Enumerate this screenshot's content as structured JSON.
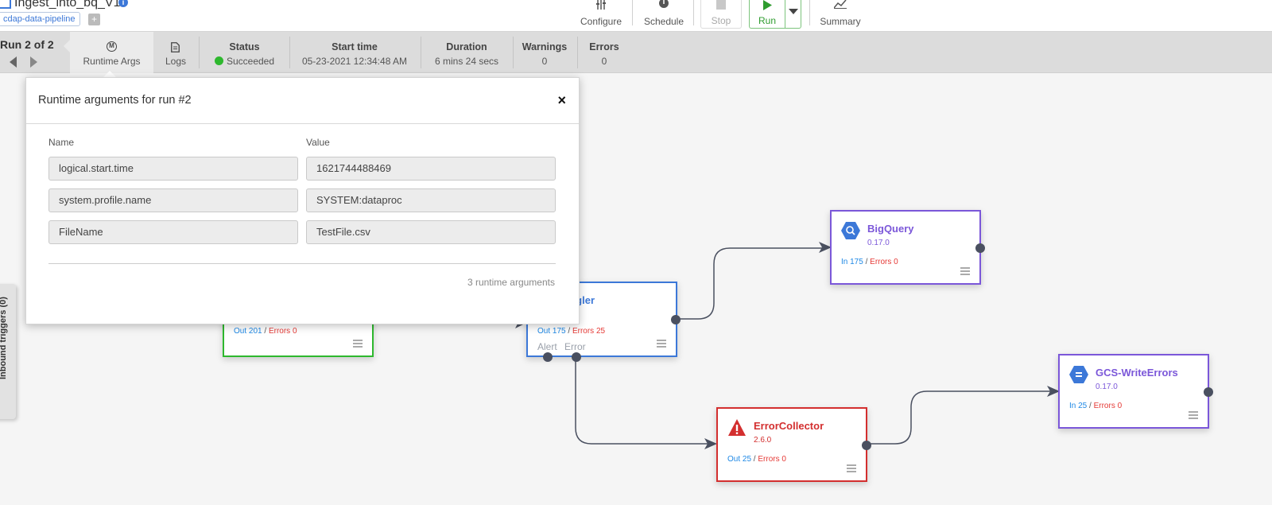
{
  "header": {
    "pipeline_name": "Ingest_into_bq_V1",
    "namespace_tag": "cdap-data-pipeline",
    "add_tag_label": "+",
    "info_label": "i",
    "toolbar": {
      "configure": "Configure",
      "schedule": "Schedule",
      "stop": "Stop",
      "run": "Run",
      "summary": "Summary"
    }
  },
  "run_info": {
    "run_counter": "Run 2 of 2",
    "runtime_args_tab": "Runtime Args",
    "runtime_args_icon_letter": "M",
    "logs_tab": "Logs",
    "status": {
      "label": "Status",
      "value": "Succeeded",
      "color": "#2eb82e"
    },
    "start_time": {
      "label": "Start time",
      "value": "05-23-2021 12:34:48 AM"
    },
    "duration": {
      "label": "Duration",
      "value": "6 mins 24 secs"
    },
    "warnings": {
      "label": "Warnings",
      "value": "0"
    },
    "errors": {
      "label": "Errors",
      "value": "0"
    }
  },
  "modal": {
    "title": "Runtime arguments for run #2",
    "close_label": "×",
    "name_header": "Name",
    "value_header": "Value",
    "args": [
      {
        "name": "logical.start.time",
        "value": "1621744488469"
      },
      {
        "name": "system.profile.name",
        "value": "SYSTEM:dataproc"
      },
      {
        "name": "FileName",
        "value": "TestFile.csv"
      }
    ],
    "count_text": "3 runtime arguments"
  },
  "canvas": {
    "inbound_triggers_label": "Inbound triggers (0)",
    "nodes": {
      "source": {
        "out_label": "Out 201",
        "sep": " / ",
        "errors_label": "Errors 0",
        "border_color": "#2eb82e"
      },
      "wrangler": {
        "title_fragment": "angler",
        "out_label": "Out 175",
        "sep": " / ",
        "errors_label": "Errors 25",
        "alert_port": "Alert",
        "error_port": "Error",
        "border_color": "#3c78d8"
      },
      "bigquery": {
        "title": "BigQuery",
        "version": "0.17.0",
        "in_label": "In 175",
        "sep": " / ",
        "errors_label": "Errors 0",
        "border_color": "#7b57d9"
      },
      "error_collector": {
        "title": "ErrorCollector",
        "version": "2.6.0",
        "out_label": "Out 25",
        "sep": " / ",
        "errors_label": "Errors 0",
        "border_color": "#d32f2f"
      },
      "gcs_write_errors": {
        "title": "GCS-WriteErrors",
        "version": "0.17.0",
        "in_label": "In 25",
        "sep": " / ",
        "errors_label": "Errors 0",
        "border_color": "#7b57d9"
      }
    }
  }
}
